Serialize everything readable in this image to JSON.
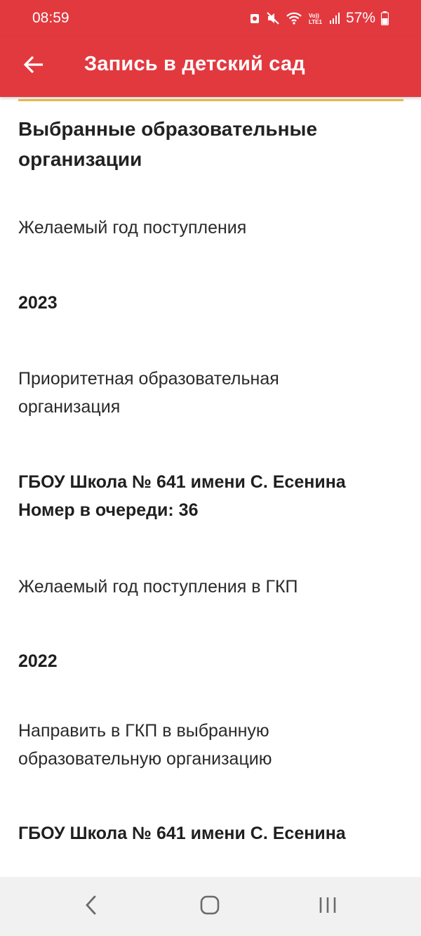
{
  "status_bar": {
    "time": "08:59",
    "battery": "57%",
    "icons": [
      "notification-icon",
      "mute-icon",
      "wifi-icon",
      "volte-icon",
      "signal-icon",
      "battery-icon"
    ]
  },
  "app_bar": {
    "title": "Запись в детский сад",
    "back_icon": "back-arrow-icon",
    "background_color": "#e2393f",
    "accent_color": "#e8b64a"
  },
  "section": {
    "heading": "Выбранные образовательные организации",
    "fields": [
      {
        "label": "Желаемый год поступления",
        "value": "2023"
      },
      {
        "label": "Приоритетная образовательная организация",
        "value": "ГБОУ Школа № 641 имени С. Есенина",
        "value2": "Номер в очереди: 36"
      },
      {
        "label": "Желаемый год поступления в ГКП",
        "value": "2022"
      },
      {
        "label": "Направить в ГКП в выбранную образовательную организацию",
        "value": "ГБОУ Школа № 641 имени С. Есенина"
      }
    ]
  },
  "nav_bar": {
    "buttons": [
      "back-nav-icon",
      "home-nav-icon",
      "recents-nav-icon"
    ]
  }
}
